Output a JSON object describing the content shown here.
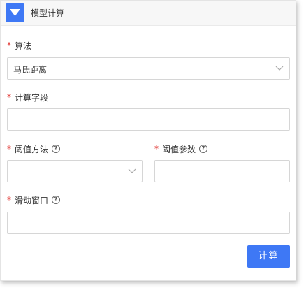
{
  "header": {
    "title": "模型计算"
  },
  "form": {
    "algorithm": {
      "label": "算法",
      "value": "马氏距离"
    },
    "calc_field": {
      "label": "计算字段",
      "value": ""
    },
    "threshold_method": {
      "label": "阈值方法",
      "value": ""
    },
    "threshold_param": {
      "label": "阈值参数",
      "value": ""
    },
    "sliding_window": {
      "label": "滑动窗口",
      "value": ""
    },
    "required_mark": "*",
    "help_glyph": "?"
  },
  "actions": {
    "submit_label": "计算"
  },
  "colors": {
    "accent": "#3e78f5",
    "required": "#e0302c"
  },
  "icons": {
    "collapse": "triangle-down-icon",
    "dropdown": "chevron-down-icon",
    "help": "question-circle-icon"
  }
}
